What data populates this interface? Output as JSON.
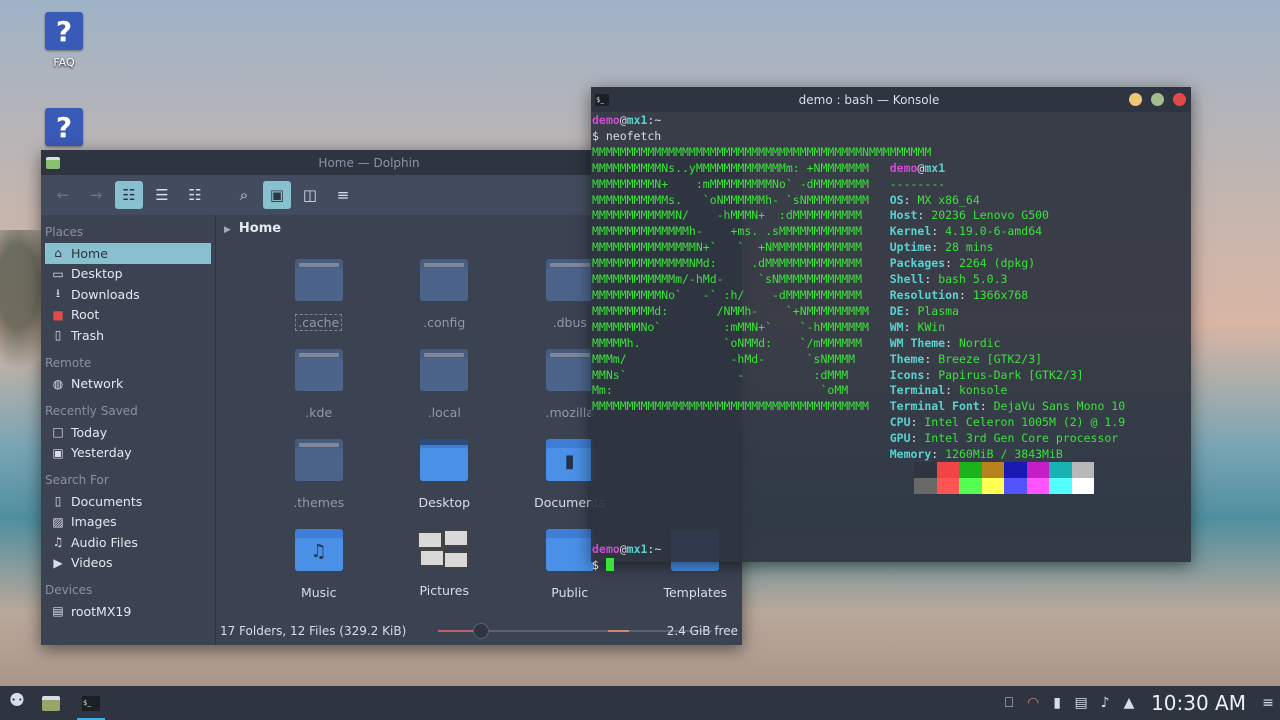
{
  "desktop": {
    "icons": [
      {
        "label": "FAQ",
        "glyph": "?"
      },
      {
        "label": "",
        "glyph": "?"
      }
    ]
  },
  "dolphin": {
    "title": "Home — Dolphin",
    "toolbar": {
      "back": "←",
      "forward": "→",
      "icons_view": "☷",
      "compact_view": "☰",
      "details_view": "☷",
      "search": "⌕",
      "preview": "▣",
      "split": "◫",
      "menu": "≡"
    },
    "places": {
      "sections": [
        {
          "title": "Places",
          "items": [
            {
              "label": "Home",
              "icon": "⌂",
              "color": "#d8dee9",
              "selected": true
            },
            {
              "label": "Desktop",
              "icon": "▭",
              "color": "#d8dee9"
            },
            {
              "label": "Downloads",
              "icon": "⭳",
              "color": "#d8dee9"
            },
            {
              "label": "Root",
              "icon": "■",
              "color": "#e24a4a"
            },
            {
              "label": "Trash",
              "icon": "▯",
              "color": "#d8dee9"
            }
          ]
        },
        {
          "title": "Remote",
          "items": [
            {
              "label": "Network",
              "icon": "◍",
              "color": "#d8dee9"
            }
          ]
        },
        {
          "title": "Recently Saved",
          "items": [
            {
              "label": "Today",
              "icon": "□",
              "color": "#d8dee9"
            },
            {
              "label": "Yesterday",
              "icon": "▣",
              "color": "#d8dee9"
            }
          ]
        },
        {
          "title": "Search For",
          "items": [
            {
              "label": "Documents",
              "icon": "▯",
              "color": "#d8dee9"
            },
            {
              "label": "Images",
              "icon": "▨",
              "color": "#d8dee9"
            },
            {
              "label": "Audio Files",
              "icon": "♫",
              "color": "#d8dee9"
            },
            {
              "label": "Videos",
              "icon": "▶",
              "color": "#d8dee9"
            }
          ]
        },
        {
          "title": "Devices",
          "items": [
            {
              "label": "rootMX19",
              "icon": "▤",
              "color": "#d8dee9"
            }
          ]
        }
      ]
    },
    "breadcrumb": "Home",
    "files": [
      {
        "name": ".cache",
        "type": "hidden",
        "focus": true
      },
      {
        "name": ".config",
        "type": "hidden"
      },
      {
        "name": ".dbus",
        "type": "hidden"
      },
      {
        "name": "",
        "type": "none"
      },
      {
        "name": ".kde",
        "type": "hidden"
      },
      {
        "name": ".local",
        "type": "hidden"
      },
      {
        "name": ".mozilla",
        "type": "hidden"
      },
      {
        "name": "",
        "type": "none"
      },
      {
        "name": ".themes",
        "type": "hidden"
      },
      {
        "name": "Desktop",
        "type": "desktop"
      },
      {
        "name": "Documents",
        "type": "documents"
      },
      {
        "name": "",
        "type": "none"
      },
      {
        "name": "Music",
        "type": "music"
      },
      {
        "name": "Pictures",
        "type": "pictures"
      },
      {
        "name": "Public",
        "type": "public"
      },
      {
        "name": "Templates",
        "type": "templates"
      }
    ],
    "status": {
      "summary": "17 Folders, 12 Files (329.2 KiB)",
      "free": "2.4 GiB free",
      "zoom_fraction": 0.25,
      "used_fraction": 0.2
    }
  },
  "konsole": {
    "title": "demo : bash — Konsole",
    "buttons": {
      "minimize": "#f0c674",
      "maximize": "#a3be8c",
      "close": "#e24a4a"
    },
    "prompt_user": "demo",
    "prompt_host": "mx1",
    "prompt_path": ":~",
    "command": "$ neofetch",
    "art": [
      "MMMMMMMMMMMMMMMMMMMMMMMMMMMMMMMMMMMMMMMNMMMMMMMMM",
      "MMMMMMMMMMNs..yMMMMMMMMMMMMMm: +NMMMMMMM",
      "MMMMMMMMMN+    :mMMMMMMMMMNo` -dMMMMMMMM",
      "MMMMMMMMMMMs.   `oNMMMMMMh- `sNMMMMMMMMM",
      "MMMMMMMMMMMMN/    -hMMMN+  :dMMMMMMMMMM",
      "MMMMMMMMMMMMMMh-    +ms. .sMMMMMMMMMMMM",
      "MMMMMMMMMMMMMMMN+`   `  +NMMMMMMMMMMMMM",
      "MMMMMMMMMMMMMMNMd:     .dMMMMMMMMMMMMMM",
      "MMMMMMMMMMMMm/-hMd-     `sNMMMMMMMMMMMM",
      "MMMMMMMMMMNo`   -` :h/    -dMMMMMMMMMMM",
      "MMMMMMMMMd:       /NMMh-    `+NMMMMMMMMM",
      "MMMMMMMNo`         :mMMN+`    `-hMMMMMMM",
      "MMMMMh.            `oNMMd:    `/mMMMMMM",
      "MMMm/               -hMd-      `sNMMMM",
      "MMNs`                -          :dMMM",
      "Mm:                              `oMM",
      "MMMMMMMMMMMMMMMMMMMMMMMMMMMMMMMMMMMMMMMM"
    ],
    "info_dashes": "--------",
    "info": [
      {
        "key": "OS",
        "value": "MX x86_64"
      },
      {
        "key": "Host",
        "value": "20236 Lenovo G500"
      },
      {
        "key": "Kernel",
        "value": "4.19.0-6-amd64"
      },
      {
        "key": "Uptime",
        "value": "28 mins"
      },
      {
        "key": "Packages",
        "value": "2264 (dpkg)"
      },
      {
        "key": "Shell",
        "value": "bash 5.0.3"
      },
      {
        "key": "Resolution",
        "value": "1366x768"
      },
      {
        "key": "DE",
        "value": "Plasma"
      },
      {
        "key": "WM",
        "value": "KWin"
      },
      {
        "key": "WM Theme",
        "value": "Nordic"
      },
      {
        "key": "Theme",
        "value": "Breeze [GTK2/3]"
      },
      {
        "key": "Icons",
        "value": "Papirus-Dark [GTK2/3]"
      },
      {
        "key": "Terminal",
        "value": "konsole"
      },
      {
        "key": "Terminal Font",
        "value": "DejaVu Sans Mono 10"
      },
      {
        "key": "CPU",
        "value": "Intel Celeron 1005M (2) @ 1.9"
      },
      {
        "key": "GPU",
        "value": "Intel 3rd Gen Core processor"
      },
      {
        "key": "Memory",
        "value": "1260MiB / 3843MiB"
      }
    ],
    "palette_top": [
      "#2e3440",
      "#f04545",
      "#1bb21b",
      "#b8821e",
      "#1818b2",
      "#c41ec4",
      "#18b2b2",
      "#b8b8b8"
    ],
    "palette_bottom": [
      "#686868",
      "#ff5454",
      "#54ff54",
      "#ffff54",
      "#5454ff",
      "#ff54ff",
      "#54ffff",
      "#ffffff"
    ],
    "prompt2_symbol": "$ "
  },
  "taskbar": {
    "menu_icon": "⚉",
    "clock": "10:30 AM",
    "tray": [
      "⎕",
      "◠",
      "▮",
      "▤",
      "♪",
      "▲",
      "≡"
    ]
  }
}
